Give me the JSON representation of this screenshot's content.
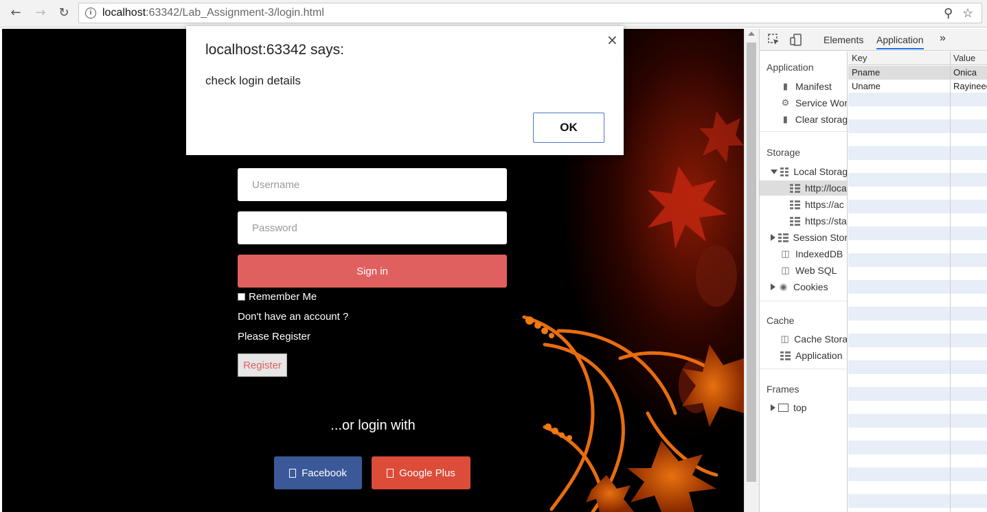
{
  "browser": {
    "url_host": "localhost",
    "url_path": ":63342/Lab_Assignment-3/login.html"
  },
  "login": {
    "username_placeholder": "Username",
    "password_placeholder": "Password",
    "signin_label": "Sign in",
    "remember_label": "Remember Me",
    "no_account_text": "Don't have an account ?",
    "please_register_text": "Please Register",
    "register_label": "Register",
    "or_login_text": "...or login with",
    "facebook_label": "Facebook",
    "google_label": "Google Plus"
  },
  "dialog": {
    "title": "localhost:63342 says:",
    "message": "check login details",
    "close": "×",
    "ok_label": "OK"
  },
  "devtools": {
    "tabs": {
      "elements": "Elements",
      "application": "Application",
      "more": "»"
    },
    "sections": {
      "application": "Application",
      "storage": "Storage",
      "cache": "Cache",
      "frames": "Frames"
    },
    "items": {
      "manifest": "Manifest",
      "service_workers": "Service Wor",
      "clear_storage": "Clear storag",
      "local_storage": "Local Storag",
      "ls_1": "http://loca",
      "ls_2": "https://ac",
      "ls_3": "https://sta",
      "session_storage": "Session Stor",
      "indexeddb": "IndexedDB",
      "web_sql": "Web SQL",
      "cookies": "Cookies",
      "cache_storage": "Cache Stora",
      "app_cache": "Application",
      "top": "top"
    },
    "table": {
      "headers": {
        "key": "Key",
        "value": "Value"
      },
      "rows": [
        {
          "key": "Pname",
          "value": "Onica"
        },
        {
          "key": "Uname",
          "value": "Rayineed"
        }
      ]
    }
  }
}
